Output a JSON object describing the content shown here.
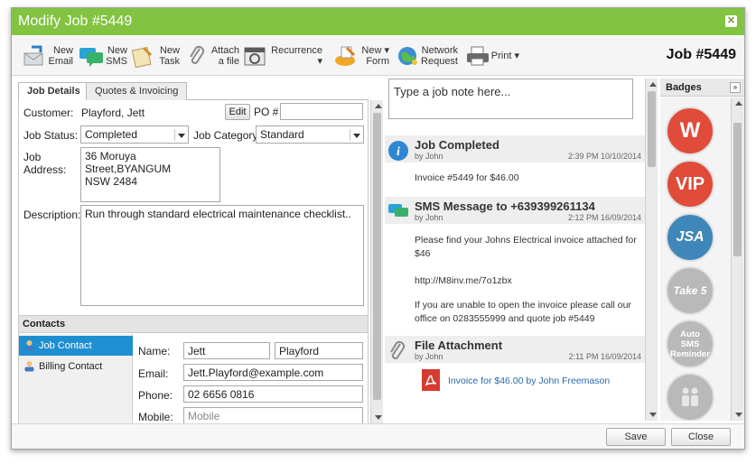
{
  "window": {
    "title": "Modify Job #5449"
  },
  "toolbar": {
    "new_email": "New Email",
    "new_sms": "New SMS",
    "new_task": "New Task",
    "attach_file": "Attach a file",
    "recurrence": "Recurrence",
    "new_form": "New Form",
    "network_request": "Network Request",
    "print": "Print",
    "job_heading": "Job #5449"
  },
  "tabs": {
    "job_details": "Job Details",
    "quotes_invoicing": "Quotes & Invoicing"
  },
  "job": {
    "customer_label": "Customer:",
    "customer_value": "Playford, Jett",
    "edit_label": "Edit",
    "po_label": "PO #",
    "po_value": "",
    "status_label": "Job Status:",
    "status_value": "Completed",
    "category_label": "Job Category",
    "category_value": "Standard",
    "address_label_1": "Job",
    "address_label_2": "Address:",
    "address_line1": "36 Moruya Street,BYANGUM",
    "address_line2": "NSW 2484",
    "description_label": "Description:",
    "description_value": "Run through standard electrical maintenance checklist.."
  },
  "contacts": {
    "header": "Contacts",
    "items": [
      {
        "label": "Job Contact"
      },
      {
        "label": "Billing Contact"
      }
    ],
    "name_label": "Name:",
    "first_name": "Jett",
    "last_name": "Playford",
    "email_label": "Email:",
    "email_value": "Jett.Playford@example.com",
    "phone_label": "Phone:",
    "phone_value": "02 6656 0816",
    "mobile_label": "Mobile:",
    "mobile_placeholder": "Mobile"
  },
  "notes": {
    "input_placeholder": "Type a job note here...",
    "items": [
      {
        "title": "Job Completed",
        "by": "by John",
        "date": "2:39 PM 10/10/2014",
        "body": "Invoice #5449 for $46.00"
      },
      {
        "title": "SMS Message to +639399261134",
        "by": "by John",
        "date": "2:12 PM 16/09/2014",
        "body1": "Please find your Johns Electrical invoice attached for $46",
        "body2": "http://M8inv.me/7o1zbx",
        "body3": "If you are unable to open the invoice please call our office on 0283555999 and quote job #5449"
      },
      {
        "title": "File Attachment",
        "by": "by John",
        "date": "2:11 PM 16/09/2014",
        "link": "Invoice for $46.00 by John Freemason"
      }
    ]
  },
  "badges": {
    "header": "Badges",
    "items": [
      {
        "label": "W",
        "color": "#e04b3a"
      },
      {
        "label": "VIP",
        "color": "#e04b3a"
      },
      {
        "label": "JSA",
        "color": "#3f87b8"
      },
      {
        "label": "Take 5",
        "color": "#b9b9b9"
      },
      {
        "label": "Auto SMS Reminder",
        "color": "#b9b9b9"
      },
      {
        "label": "",
        "color": "#b9b9b9"
      }
    ]
  },
  "footer": {
    "save": "Save",
    "close": "Close"
  }
}
